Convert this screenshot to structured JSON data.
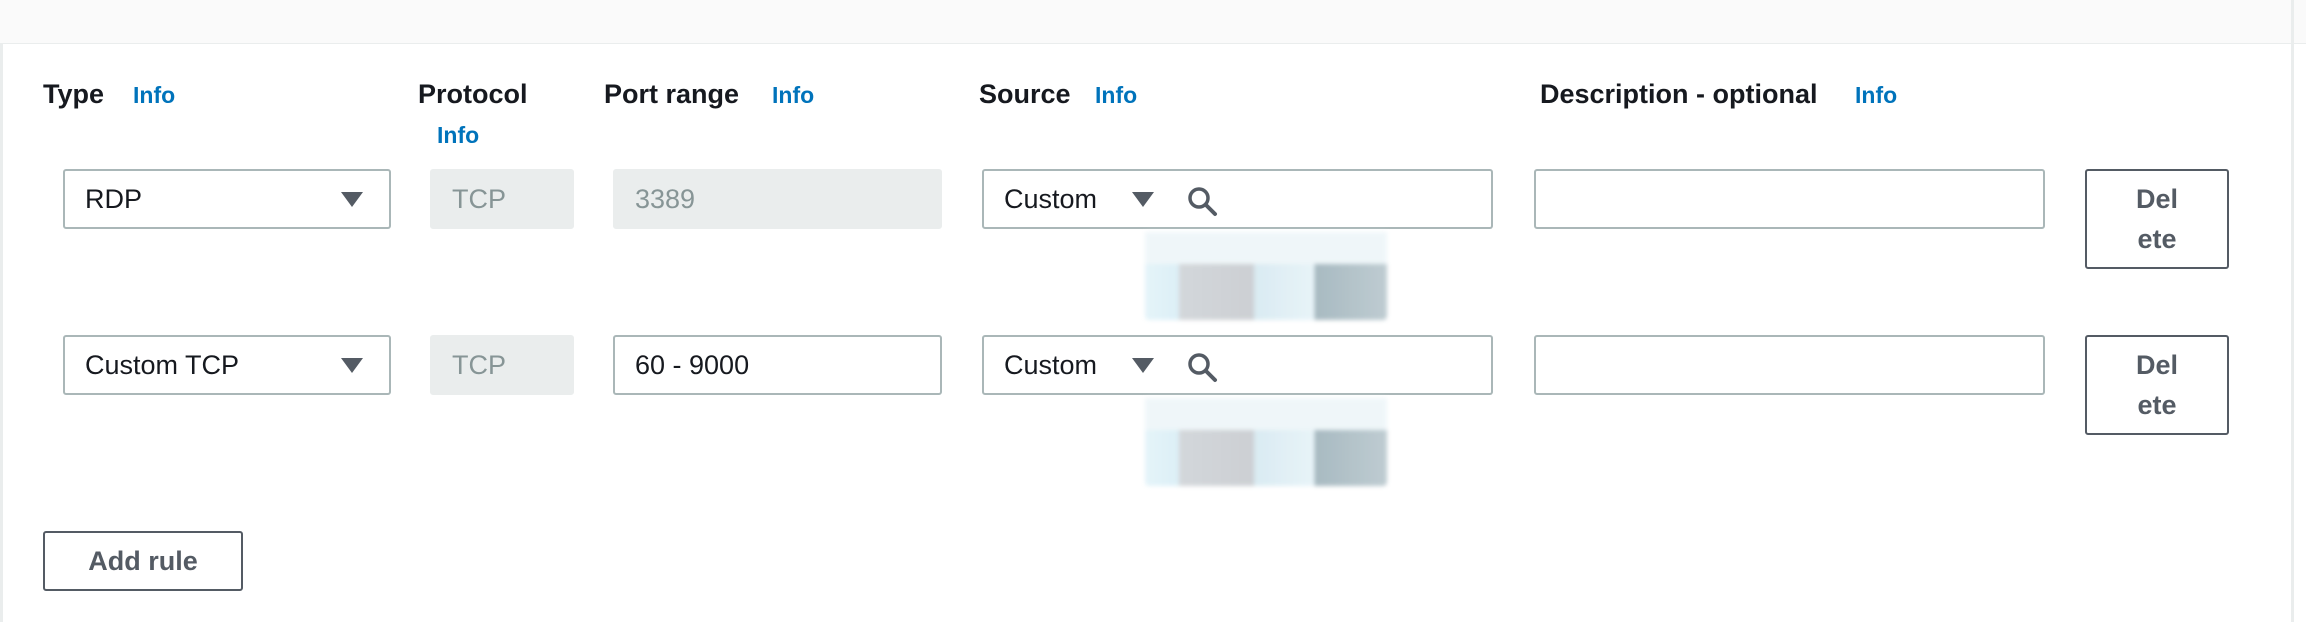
{
  "headers": {
    "type": "Type",
    "protocol": "Protocol",
    "port_range": "Port range",
    "source": "Source",
    "description": "Description - optional",
    "info": "Info"
  },
  "rules": [
    {
      "type": "RDP",
      "protocol": "TCP",
      "port_range": "3389",
      "port_editable": false,
      "source_type": "Custom",
      "source_search": "",
      "description": "",
      "delete_line1": "Del",
      "delete_line2": "ete"
    },
    {
      "type": "Custom TCP",
      "protocol": "TCP",
      "port_range": "60 - 9000",
      "port_editable": true,
      "source_type": "Custom",
      "source_search": "",
      "description": "",
      "delete_line1": "Del",
      "delete_line2": "ete"
    }
  ],
  "add_rule_label": "Add rule",
  "colors": {
    "info_link": "#0073bb",
    "border": "#aab7b8",
    "disabled_bg": "#eaeded",
    "button_text": "#545b64"
  }
}
